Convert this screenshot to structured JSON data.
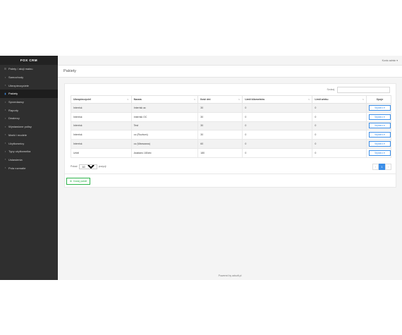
{
  "brand": "FOX CRM",
  "user_menu": "Konto admin",
  "nav": [
    {
      "icon": "file-icon",
      "glyph": "☰",
      "label": "Palety / akcji mainu"
    },
    {
      "icon": "car-icon",
      "glyph": "▪",
      "label": "Samochody"
    },
    {
      "icon": "people-icon",
      "glyph": "▪",
      "label": "Ubezpieczyciele"
    },
    {
      "icon": "box-icon",
      "glyph": "▮",
      "label": "Pakiety",
      "active": true
    },
    {
      "icon": "cart-icon",
      "glyph": "▪",
      "label": "Sprzedawcy"
    },
    {
      "icon": "chart-icon",
      "glyph": "▪",
      "label": "Raporty"
    },
    {
      "icon": "dealer-icon",
      "glyph": "▪",
      "label": "Dealerzy"
    },
    {
      "icon": "list-icon",
      "glyph": "▪",
      "label": "Wystawione polisy"
    },
    {
      "icon": "model-icon",
      "glyph": "▪",
      "label": "Marki i modele"
    },
    {
      "icon": "user-icon",
      "glyph": "▪",
      "label": "Użytkownicy"
    },
    {
      "icon": "user-types-icon",
      "glyph": "▪",
      "label": "Typy użytkownika"
    },
    {
      "icon": "gear-icon",
      "glyph": "▪",
      "label": "Ustawienia"
    },
    {
      "icon": "forms-icon",
      "glyph": "▪",
      "label": "Pola rozmaite"
    }
  ],
  "page_title": "Pakiety",
  "search_label": "Szukaj:",
  "columns": [
    "Ubezpieczyciel",
    "Nazwa",
    "Ilość dni",
    "Limit kilometrów",
    "Limit wieku",
    "Opcje"
  ],
  "rows": [
    {
      "insurer": "Interrisk",
      "name": "Interrisk ac",
      "days": "30",
      "km": "0",
      "age": "0",
      "action": "Wybierz"
    },
    {
      "insurer": "Interrisk",
      "name": "Interrisk OC",
      "days": "30",
      "km": "0",
      "age": "0",
      "action": "Wybierz"
    },
    {
      "insurer": "Interrisk",
      "name": "Test",
      "days": "30",
      "km": "0",
      "age": "0",
      "action": "Wybierz"
    },
    {
      "insurer": "Interrisk",
      "name": "oc (Rozbom)",
      "days": "30",
      "km": "0",
      "age": "0",
      "action": "Wybierz"
    },
    {
      "insurer": "Interrisk",
      "name": "oc (Warszawa)",
      "days": "60",
      "km": "0",
      "age": "0",
      "action": "Wybierz"
    },
    {
      "insurer": "Unbil",
      "name": "Assitans 180dni",
      "days": "180",
      "km": "0",
      "age": "0",
      "action": "Wybierz"
    }
  ],
  "length": {
    "before": "Pokaż",
    "value": "10",
    "after": "pozycji"
  },
  "pager": {
    "prev": "‹",
    "current": "1",
    "next": "›"
  },
  "add_button": "Dodaj pakiet",
  "footer": "Powered by adsoft.pl"
}
